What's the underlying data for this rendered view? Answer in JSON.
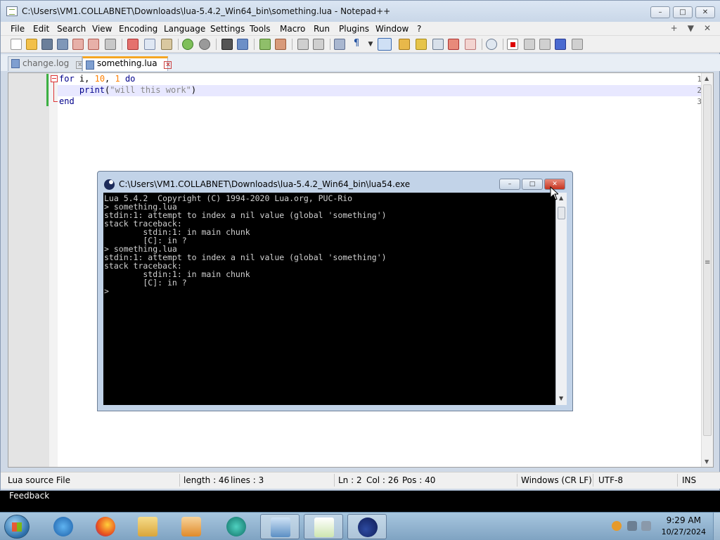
{
  "notepad": {
    "title": "C:\\Users\\VM1.COLLABNET\\Downloads\\lua-5.4.2_Win64_bin\\something.lua - Notepad++",
    "menu": [
      "File",
      "Edit",
      "Search",
      "View",
      "Encoding",
      "Language",
      "Settings",
      "Tools",
      "Macro",
      "Run",
      "Plugins",
      "Window",
      "?"
    ],
    "menu_right": [
      "+",
      "▼",
      "✕"
    ],
    "window_buttons": [
      "–",
      "□",
      "✕"
    ],
    "tabs": [
      {
        "label": "change.log",
        "active": false
      },
      {
        "label": "something.lua",
        "active": true
      }
    ],
    "editor": {
      "line_numbers": [
        "1",
        "2",
        "3"
      ],
      "lines": [
        {
          "kw": "for",
          "var": " i, ",
          "n1": "10",
          "sep": ", ",
          "n2": "1",
          "kw2": " do"
        },
        {
          "indent": "    ",
          "fn": "print",
          "open": "(",
          "str": "\"will this work\"",
          "close": ")"
        },
        {
          "kw": "end"
        }
      ]
    },
    "status": {
      "filetype": "Lua source File",
      "length": "length : 46",
      "lines": "lines : 3",
      "ln": "Ln : 2",
      "col": "Col : 26",
      "pos": "Pos : 40",
      "eol": "Windows (CR LF)",
      "encoding": "UTF-8",
      "mode": "INS"
    }
  },
  "feedback": "Feedback",
  "console": {
    "title": "C:\\Users\\VM1.COLLABNET\\Downloads\\lua-5.4.2_Win64_bin\\lua54.exe",
    "window_buttons": [
      "–",
      "□",
      "✕"
    ],
    "lines": [
      "Lua 5.4.2  Copyright (C) 1994-2020 Lua.org, PUC-Rio",
      "> something.lua",
      "stdin:1: attempt to index a nil value (global 'something')",
      "stack traceback:",
      "        stdin:1: in main chunk",
      "        [C]: in ?",
      "> something.lua",
      "stdin:1: attempt to index a nil value (global 'something')",
      "stack traceback:",
      "        stdin:1: in main chunk",
      "        [C]: in ?",
      ">"
    ]
  },
  "taskbar": {
    "apps": [
      "internet-explorer",
      "firefox",
      "file-explorer",
      "media-player",
      "browser-app",
      "control-panel",
      "notepad-plus-plus",
      "lua"
    ],
    "clock": {
      "time": "9:29 AM",
      "date": "10/27/2024"
    }
  },
  "colors": {
    "keyword": "#00008b",
    "number": "#ff8000",
    "string": "#8a8a8a",
    "console_bg": "#000000",
    "console_text": "#d0d0d0",
    "active_tab_accent": "#f5a623"
  }
}
